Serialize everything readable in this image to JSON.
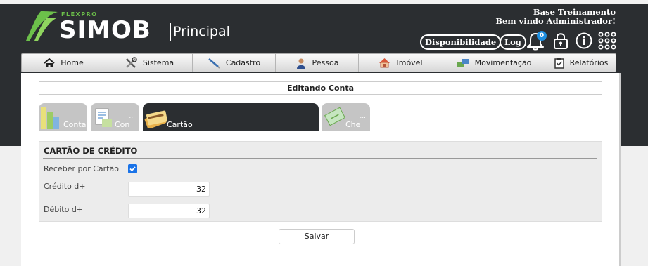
{
  "header": {
    "logo_brand": "FLEXPRO",
    "logo_product": "SIMOB",
    "logo_module": "Principal",
    "company": "Base Treinamento",
    "welcome": "Bem vindo Administrador!",
    "availability_label": "Disponibilidade",
    "log_label": "Log",
    "notification_count": "0"
  },
  "nav": {
    "items": [
      {
        "label": "Home",
        "icon": "home-icon"
      },
      {
        "label": "Sistema",
        "icon": "tools-icon"
      },
      {
        "label": "Cadastro",
        "icon": "pen-icon"
      },
      {
        "label": "Pessoa",
        "icon": "person-icon"
      },
      {
        "label": "Imóvel",
        "icon": "house-icon"
      },
      {
        "label": "Movimentação",
        "icon": "transfer-icon"
      },
      {
        "label": "Relatórios",
        "icon": "clipboard-icon"
      }
    ]
  },
  "page": {
    "title": "Editando Conta"
  },
  "tabs": [
    {
      "label": "Conta",
      "icon": "bar-chart-icon",
      "active": false
    },
    {
      "label": "Con",
      "icon": "document-icon",
      "active": false
    },
    {
      "label": "Cartão",
      "icon": "card-icon",
      "active": true
    },
    {
      "label": "Che",
      "icon": "check-book-icon",
      "active": false
    }
  ],
  "form": {
    "section_title": "CARTÃO DE CRÉDITO",
    "receber_label": "Receber por Cartão",
    "receber_checked": true,
    "credito_label": "Crédito d+",
    "credito_value": "32",
    "debito_label": "Débito d+",
    "debito_value": "32"
  },
  "actions": {
    "save_label": "Salvar"
  },
  "colors": {
    "header_bg": "#2b2e31",
    "brand_green": "#6cc04a",
    "checkbox_blue": "#1a73e8",
    "badge_blue": "#1e8fe0"
  }
}
